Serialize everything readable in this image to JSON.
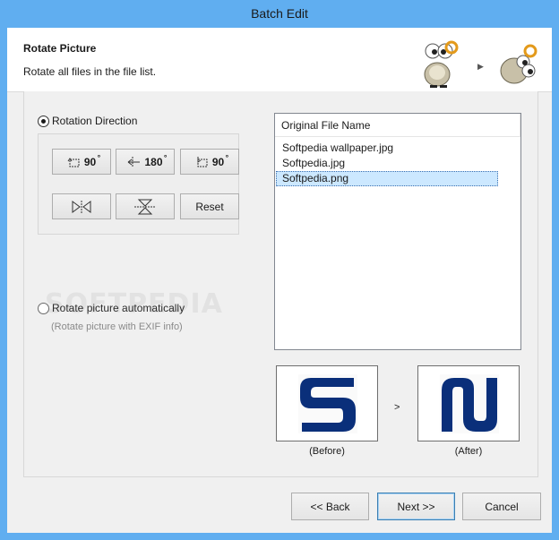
{
  "window": {
    "title": "Batch Edit"
  },
  "header": {
    "title": "Rotate Picture",
    "subtitle": "Rotate all files in the file list."
  },
  "options": {
    "rotation_direction_label": "Rotation Direction",
    "rotation_direction_checked": true,
    "rotate_auto_label": "Rotate picture automatically",
    "rotate_auto_note": "(Rotate picture with EXIF info)",
    "watermark": "SOFTPEDIA"
  },
  "rotate_buttons": {
    "rotate_left": {
      "icon": "rotate-left-icon",
      "label": "90"
    },
    "rotate_180": {
      "icon": "rotate-180-icon",
      "label": "180"
    },
    "rotate_right": {
      "icon": "rotate-right-icon",
      "label": "90"
    },
    "flip_horizontal": {
      "icon": "flip-horizontal-icon"
    },
    "flip_vertical": {
      "icon": "flip-vertical-icon"
    },
    "reset": "Reset"
  },
  "file_list": {
    "column_header": "Original File Name",
    "files": [
      "Softpedia wallpaper.jpg",
      "Softpedia.jpg",
      "Softpedia.png"
    ],
    "selected_file": "Softpedia.png"
  },
  "preview": {
    "before_label": "(Before)",
    "after_label": "(After)",
    "separator": ">",
    "logo_color": "#0a2f7a"
  },
  "footer": {
    "back": "<< Back",
    "next": "Next >>",
    "cancel": "Cancel"
  }
}
